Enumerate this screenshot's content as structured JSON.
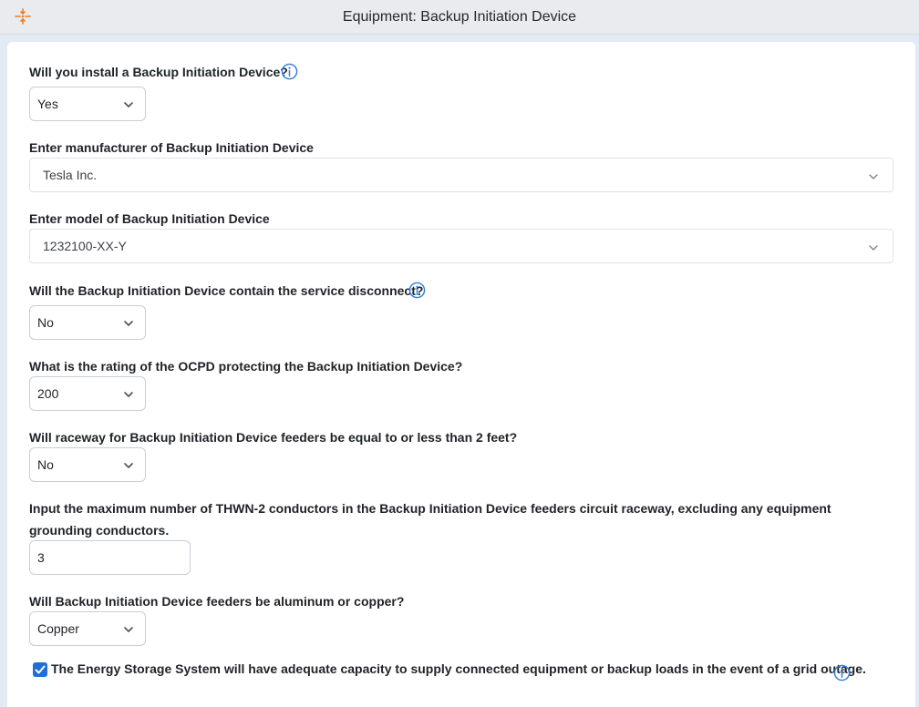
{
  "window": {
    "title": "Equipment: Backup Initiation Device",
    "logo_icon": "app-logo-icon"
  },
  "colors": {
    "accent": "#1f6fd6",
    "logo": "#f07a1f",
    "info_icon": "#2f7de1"
  },
  "form": {
    "install_bid": {
      "label": "Will you install a Backup Initiation Device?",
      "value": "Yes",
      "icon": "info-icon"
    },
    "manufacturer": {
      "label": "Enter manufacturer of Backup Initiation Device",
      "value": "Tesla Inc."
    },
    "model": {
      "label": "Enter model of Backup Initiation Device",
      "value": "1232100-XX-Y"
    },
    "service_disconnect": {
      "label": "Will the Backup Initiation Device contain the service disconnect?",
      "value": "No",
      "icon": "info-icon"
    },
    "ocpd_rating": {
      "label": "What is the rating of the OCPD protecting the Backup Initiation Device?",
      "value": "200"
    },
    "raceway_length": {
      "label": "Will raceway for Backup Initiation Device feeders be equal to or less than 2 feet?",
      "value": "No"
    },
    "conductor_count": {
      "label": "Input the maximum number of THWN-2 conductors in the Backup Initiation Device feeders circuit raceway, excluding any equipment grounding conductors.",
      "value": "3"
    },
    "feeder_material": {
      "label": "Will Backup Initiation Device feeders be aluminum or copper?",
      "value": "Copper"
    },
    "capacity_confirm": {
      "label": "The Energy Storage System will have adequate capacity to supply connected equipment or backup loads in the event of a grid outage.",
      "checked": true,
      "icon": "info-icon"
    }
  }
}
